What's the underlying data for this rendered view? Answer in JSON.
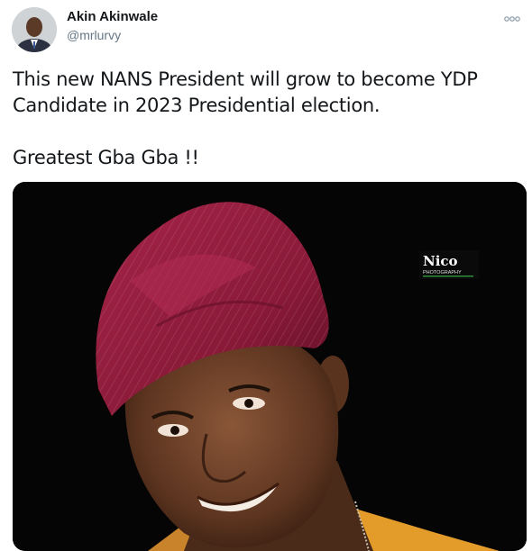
{
  "author": {
    "display_name": "Akin Akinwale",
    "handle": "@mrlurvy"
  },
  "icons": {
    "more": "more-options-icon",
    "avatar": "profile-photo"
  },
  "tweet": {
    "lines": [
      "This new NANS President will grow to become YDP",
      "Candidate in 2023 Presidential election."
    ],
    "closing": "Greatest Gba Gba !!"
  },
  "media": {
    "watermark_logo": "Nico",
    "watermark_sub": "PHOTOGRAPHY"
  },
  "colors": {
    "text": "#14171a",
    "secondary": "#657786",
    "cap": "#8e1b3b",
    "shirt": "#e39b2a"
  }
}
